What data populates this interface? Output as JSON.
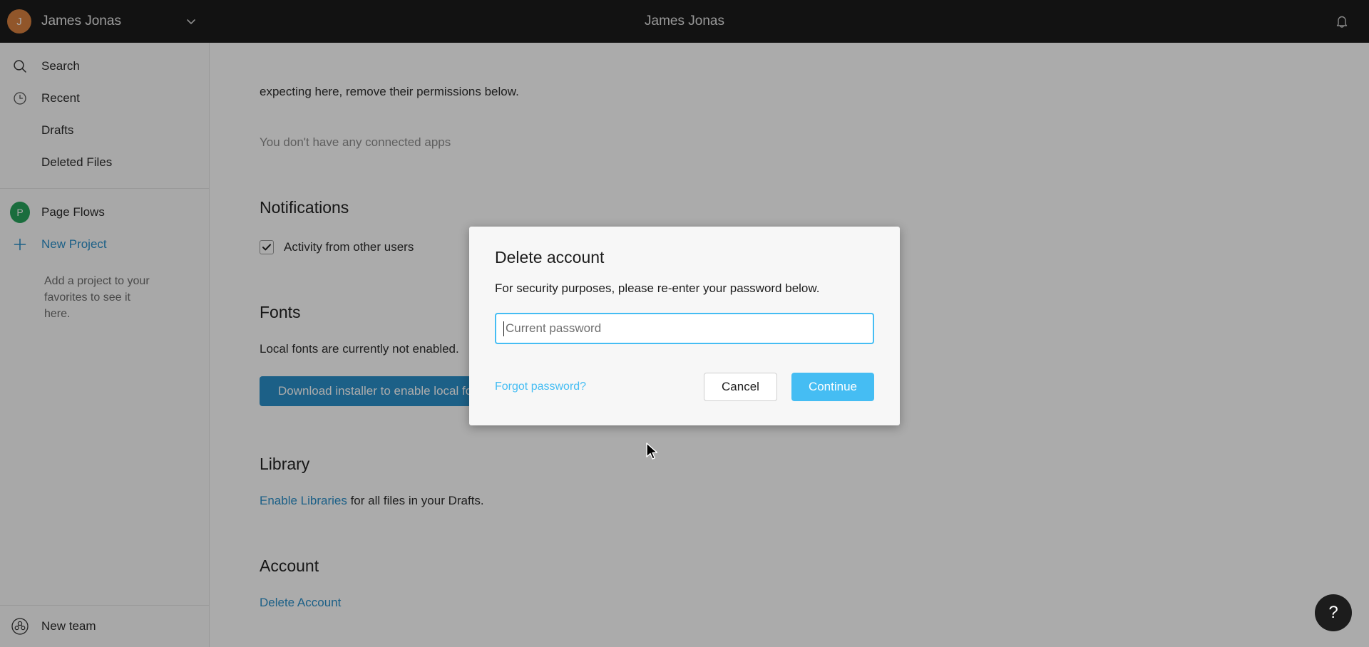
{
  "topbar": {
    "user_initial": "J",
    "user_name": "James Jonas",
    "center_title": "James Jonas",
    "chevron_icon": "chevron-down-icon",
    "bell_icon": "bell-icon",
    "avatar_color": "#d9813f",
    "background_color": "#1c1c1c"
  },
  "sidebar": {
    "nav_items": [
      {
        "label": "Search",
        "icon": "search-icon"
      },
      {
        "label": "Recent",
        "icon": "clock-icon"
      },
      {
        "label": "Drafts",
        "icon": "none"
      },
      {
        "label": "Deleted Files",
        "icon": "none"
      }
    ],
    "projects": [
      {
        "label": "Page Flows",
        "icon": "project-avatar",
        "initial": "P",
        "color": "#27a35b",
        "is_link": false
      },
      {
        "label": "New Project",
        "icon": "plus-icon",
        "is_link": true
      }
    ],
    "favorites_hint": "Add a project to your favorites to see it here.",
    "bottom": {
      "label": "New team",
      "icon": "team-icon"
    }
  },
  "main": {
    "apps_paragraph": "expecting here, remove their permissions below.",
    "no_apps_text": "You don't have any connected apps",
    "notifications": {
      "heading": "Notifications",
      "checkbox_label": "Activity from other users",
      "checkbox_checked": true,
      "check_icon": "check-icon"
    },
    "fonts": {
      "heading": "Fonts",
      "status_text": "Local fonts are currently not enabled.",
      "button_label": "Download installer to enable local fonts",
      "button_color": "#2b8fc9"
    },
    "library": {
      "heading": "Library",
      "link_label": "Enable Libraries",
      "trailing_text": " for all files in your Drafts."
    },
    "account": {
      "heading": "Account",
      "delete_link_label": "Delete Account"
    }
  },
  "modal": {
    "title": "Delete account",
    "subtitle": "For security purposes, please re-enter your password below.",
    "password_placeholder": "Current password",
    "password_value": "",
    "forgot_label": "Forgot password?",
    "cancel_label": "Cancel",
    "continue_label": "Continue",
    "accent_color": "#45bdf3"
  },
  "help": {
    "label": "?",
    "icon": "question-mark-icon"
  }
}
